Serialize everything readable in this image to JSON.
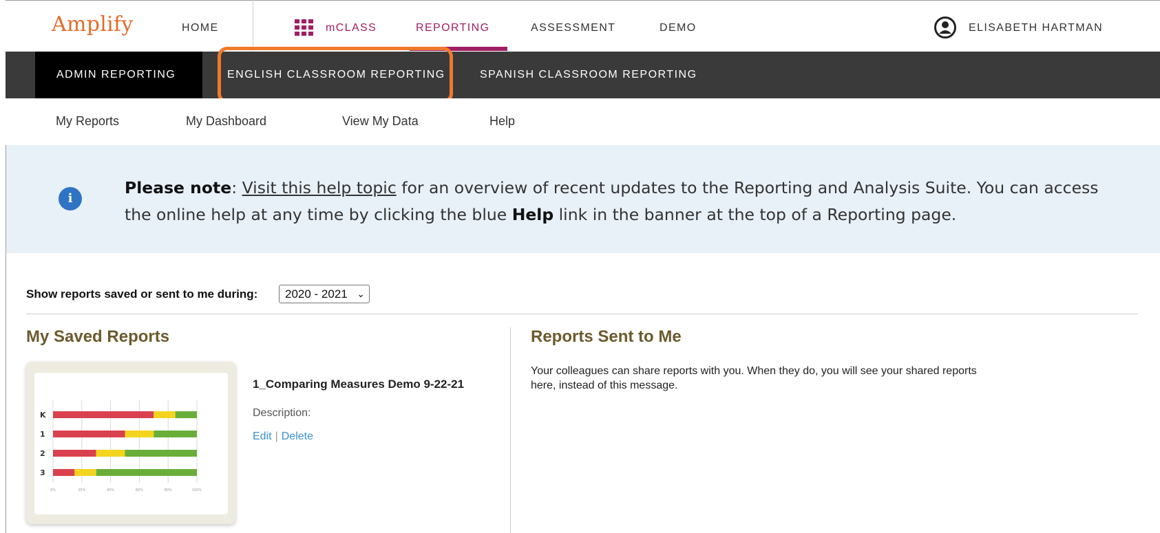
{
  "topnav": {
    "logo": "Amplify",
    "items": [
      {
        "label": "HOME"
      },
      {
        "label": "mCLASS"
      },
      {
        "label": "REPORTING"
      },
      {
        "label": "ASSESSMENT"
      },
      {
        "label": "DEMO"
      }
    ],
    "user_name": "ELISABETH HARTMAN"
  },
  "reporting_tabs": [
    {
      "label": "ADMIN REPORTING",
      "active": true
    },
    {
      "label": "ENGLISH CLASSROOM REPORTING",
      "highlighted": true
    },
    {
      "label": "SPANISH CLASSROOM REPORTING"
    }
  ],
  "subnav": [
    {
      "label": "My Reports"
    },
    {
      "label": "My Dashboard"
    },
    {
      "label": "View My Data"
    },
    {
      "label": "Help"
    }
  ],
  "notice": {
    "lead": "Please note",
    "colon": ": ",
    "link_text": "Visit this help topic",
    "text_1": " for an overview of recent updates to the Reporting and Analysis Suite. You can access the online help at any time by clicking the blue ",
    "bold_word": "Help",
    "text_2": " link in the banner at the top of a Reporting page."
  },
  "filter": {
    "label": "Show reports saved or sent to me during:",
    "selected": "2020 - 2021"
  },
  "saved_reports": {
    "heading": "My Saved Reports",
    "items": [
      {
        "title": "1_Comparing Measures Demo 9-22-21",
        "description": "Description:",
        "edit_label": "Edit",
        "delete_label": "Delete"
      }
    ],
    "thumbnail": {
      "rows": [
        "K",
        "1",
        "2",
        "3"
      ],
      "segments": [
        [
          0.7,
          0.15,
          0.15
        ],
        [
          0.5,
          0.2,
          0.3
        ],
        [
          0.3,
          0.2,
          0.5
        ],
        [
          0.15,
          0.15,
          0.7
        ]
      ],
      "ticks": [
        "0%",
        "20%",
        "40%",
        "60%",
        "80%",
        "100%"
      ],
      "colors": {
        "red": "#d9414f",
        "yellow": "#f3d41e",
        "green": "#6aae3a"
      }
    }
  },
  "sent_reports": {
    "heading": "Reports Sent to Me",
    "message": "Your colleagues can share reports with you. When they do, you will see your shared reports here, instead of this message."
  },
  "colors": {
    "brand_orange": "#e46b29",
    "magenta": "#a01e63",
    "highlight": "#ef7a2c",
    "link_blue": "#3a8fd1",
    "heading_olive": "#6b5a2c"
  }
}
